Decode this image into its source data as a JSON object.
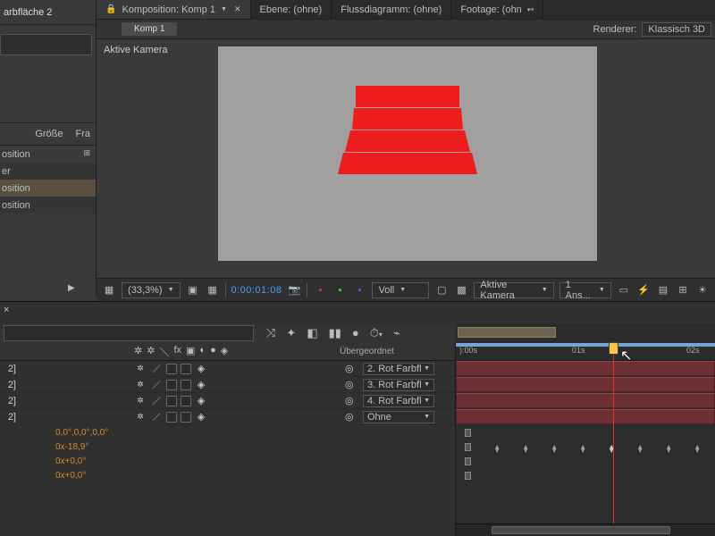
{
  "project": {
    "top_item": "arbfläche 2",
    "col_size": "Größe",
    "col_fr": "Fra",
    "rows": [
      {
        "label": "osition",
        "flow": true
      },
      {
        "label": "er"
      },
      {
        "label": "osition",
        "selected": true
      },
      {
        "label": "osition"
      }
    ]
  },
  "comp": {
    "tabs": [
      {
        "label": "Komposition: Komp 1",
        "active": true,
        "lock": true,
        "close": true,
        "dd": true
      },
      {
        "label": "Ebene: (ohne)"
      },
      {
        "label": "Flussdiagramm: (ohne)"
      },
      {
        "label": "Footage: (ohn"
      }
    ],
    "crumb": "Komp 1",
    "renderer_label": "Renderer:",
    "renderer_value": "Klassisch 3D",
    "camera_label": "Aktive Kamera",
    "toolbar": {
      "zoom": "(33,3%)",
      "timecode": "0:00:01:08",
      "res": "Voll",
      "view": "Aktive Kamera",
      "views": "1 Ans..."
    }
  },
  "timeline": {
    "parent_header": "Übergeordnet",
    "ruler": [
      "):00s",
      "01s",
      "02s"
    ],
    "layers": [
      {
        "num": "2]",
        "parent": "2. Rot Farbfl"
      },
      {
        "num": "2]",
        "parent": "3. Rot Farbfl"
      },
      {
        "num": "2]",
        "parent": "4. Rot Farbfl"
      },
      {
        "num": "2]",
        "parent": "Ohne"
      }
    ],
    "props": [
      "0,0°,0,0°,0,0°",
      "0x-18,9°",
      "0x+0,0°",
      "0x+0,0°"
    ]
  }
}
